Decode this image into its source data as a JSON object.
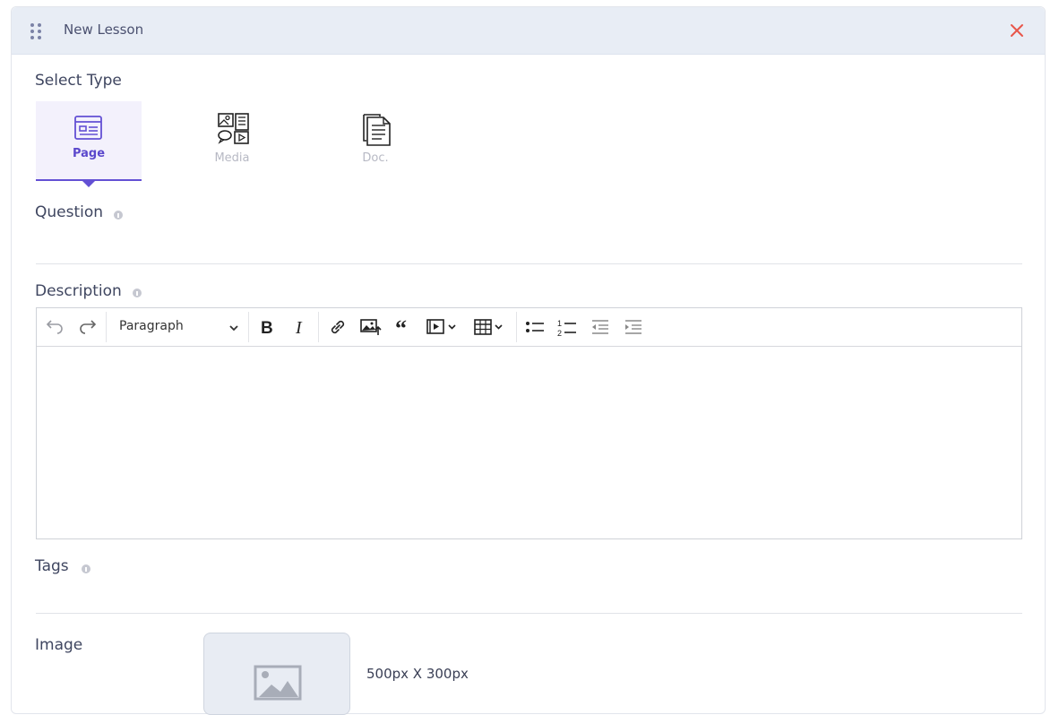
{
  "header": {
    "title": "New Lesson"
  },
  "select_type": {
    "label": "Select Type",
    "options": [
      {
        "label": "Page",
        "icon": "page-icon",
        "active": true
      },
      {
        "label": "Media",
        "icon": "media-icon",
        "active": false
      },
      {
        "label": "Doc.",
        "icon": "doc-icon",
        "active": false
      }
    ]
  },
  "question": {
    "label": "Question",
    "value": ""
  },
  "description": {
    "label": "Description",
    "paragraph_select": "Paragraph",
    "toolbar_icons": [
      "undo-icon",
      "redo-icon",
      "bold-icon",
      "italic-icon",
      "link-icon",
      "insert-image-icon",
      "blockquote-icon",
      "media-embed-icon",
      "table-icon",
      "bulleted-list-icon",
      "numbered-list-icon",
      "outdent-icon",
      "indent-icon"
    ],
    "content": ""
  },
  "tags": {
    "label": "Tags",
    "value": ""
  },
  "image": {
    "label": "Image",
    "size_hint": "500px X 300px"
  },
  "colors": {
    "accent": "#6350d4",
    "close": "#e8564a",
    "header_bg": "#e8edf5"
  }
}
